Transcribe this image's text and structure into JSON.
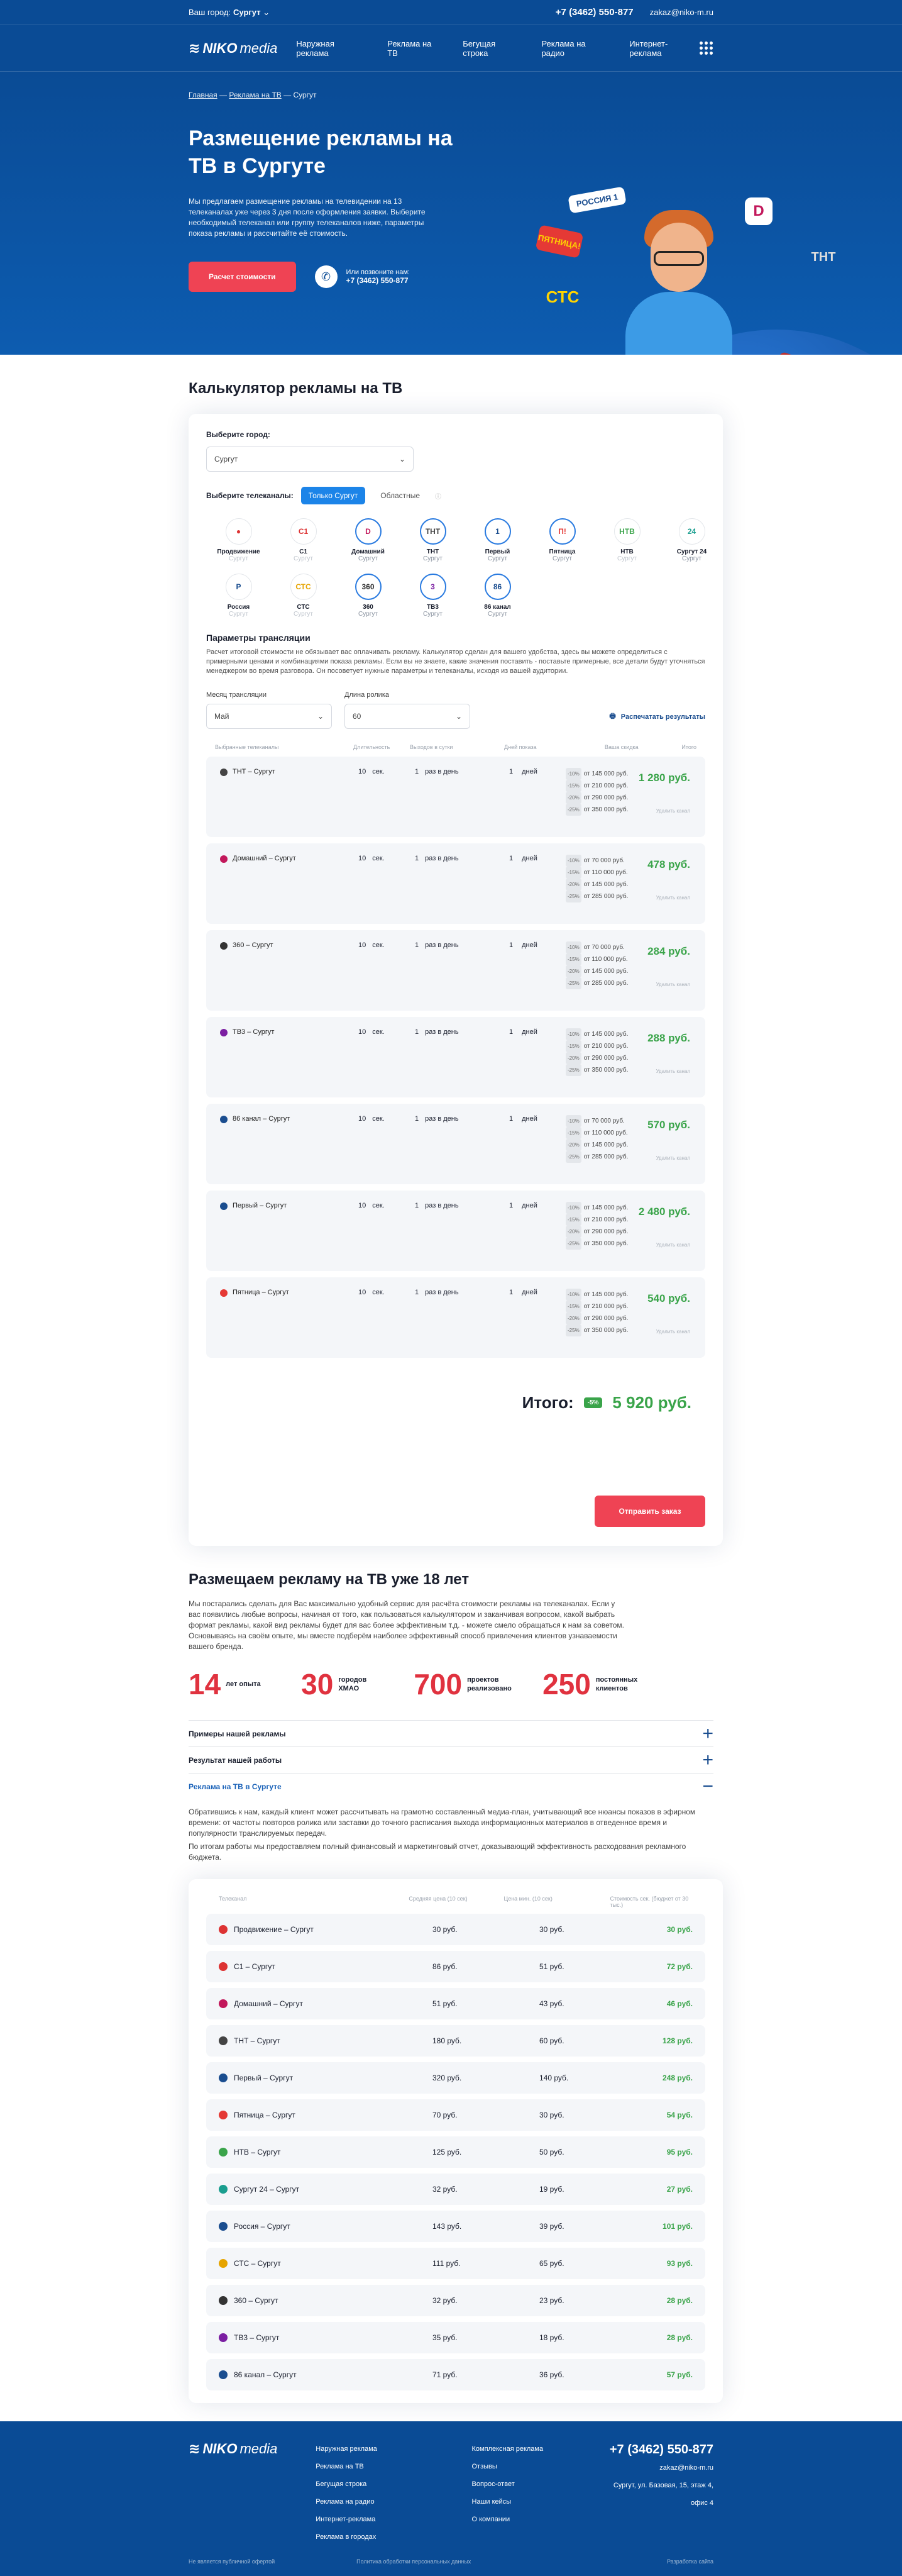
{
  "topbar": {
    "city_label": "Ваш город:",
    "city": "Сургут",
    "phone": "+7 (3462) 550-877",
    "email": "zakaz@niko-m.ru"
  },
  "nav": {
    "logo_a": "NIKO",
    "logo_b": "media",
    "items": [
      "Наружная реклама",
      "Реклама на ТВ",
      "Бегущая строка",
      "Реклама на радио",
      "Интернет-реклама"
    ]
  },
  "hero": {
    "breadcrumbs": [
      "Главная",
      "Реклама на ТВ",
      "Сургут"
    ],
    "title": "Размещение рекламы на ТВ в Сургуте",
    "text": "Мы предлагаем размещение рекламы на телевидении на 13 телеканалах уже через 3 дня после оформления заявки. Выберите необходимый телеканал или группу телеканалов ниже, параметры показа рекламы и рассчитайте её стоимость.",
    "cta": "Расчет стоимости",
    "call_label": "Или позвоните нам:",
    "phone": "+7 (3462) 550-877",
    "badges": [
      "РОССИЯ 1",
      "ПЯТНИЦА!",
      "СТС",
      "ТНТ",
      "D"
    ]
  },
  "calc": {
    "title": "Калькулятор рекламы на ТВ",
    "city_label": "Выберите город:",
    "city": "Сургут",
    "channels_label": "Выберите телеканалы:",
    "tab_local": "Только Сургут",
    "tab_regional": "Областные",
    "channels": [
      {
        "name": "Продвижение",
        "city": "Сургут",
        "mark": "●",
        "color": "#d33",
        "sel": false,
        "dim": true
      },
      {
        "name": "C1",
        "city": "Сургут",
        "mark": "C1",
        "color": "#d33",
        "sel": false,
        "dim": true
      },
      {
        "name": "Домашний",
        "city": "Сургут",
        "mark": "D",
        "color": "#c2185b",
        "sel": true,
        "dim": false
      },
      {
        "name": "ТНТ",
        "city": "Сургут",
        "mark": "ТНТ",
        "color": "#444",
        "sel": true,
        "dim": false
      },
      {
        "name": "Первый",
        "city": "Сургут",
        "mark": "1",
        "color": "#1a4d8f",
        "sel": true,
        "dim": false
      },
      {
        "name": "Пятница",
        "city": "Сургут",
        "mark": "П!",
        "color": "#e53935",
        "sel": true,
        "dim": false
      },
      {
        "name": "НТВ",
        "city": "Сургут",
        "mark": "НТВ",
        "color": "#3aa44a",
        "sel": false,
        "dim": true
      },
      {
        "name": "Сургут 24",
        "city": "Сургут",
        "mark": "24",
        "color": "#1a9e8f",
        "sel": false,
        "dim": false
      },
      {
        "name": "Россия",
        "city": "Сургут",
        "mark": "Р",
        "color": "#1a4d8f",
        "sel": false,
        "dim": true
      },
      {
        "name": "СТС",
        "city": "Сургут",
        "mark": "СТС",
        "color": "#e6a400",
        "sel": false,
        "dim": true
      },
      {
        "name": "360",
        "city": "Сургут",
        "mark": "360",
        "color": "#333",
        "sel": true,
        "dim": false
      },
      {
        "name": "ТВ3",
        "city": "Сургут",
        "mark": "3",
        "color": "#7b1fa2",
        "sel": true,
        "dim": false
      },
      {
        "name": "86 канал",
        "city": "Сургут",
        "mark": "86",
        "color": "#1a4d8f",
        "sel": true,
        "dim": false
      }
    ],
    "params_title": "Параметры трансляции",
    "params_text": "Расчет итоговой стоимости не обязывает вас оплачивать рекламу. Калькулятор сделан для вашего удобства, здесь вы можете определиться с примерными ценами и комбинациями показа рекламы. Если вы не знаете, какие значения поставить - поставьте примерные, все детали будут уточняться менеджером во время разговора. Он посоветует нужные параметры и телеканалы, исходя из вашей аудитории.",
    "month_label": "Месяц трансляции",
    "month": "Май",
    "dur_label": "Длина ролика",
    "dur": "60",
    "download": "Распечатать результаты",
    "headers": [
      "Выбранные телеканалы",
      "Длительность",
      "Выходов в сутки",
      "Дней показа",
      "Ваша скидка",
      "Итого"
    ],
    "rows": [
      {
        "name": "ТНТ – Сургут",
        "color": "#444",
        "sec": "10",
        "per": "1",
        "days": "1",
        "d": [
          "от 145 000 руб.",
          "от 210 000 руб.",
          "от 290 000 руб.",
          "от 350 000 руб."
        ],
        "price": "1 280 руб."
      },
      {
        "name": "Домашний – Сургут",
        "color": "#c2185b",
        "sec": "10",
        "per": "1",
        "days": "1",
        "d": [
          "от 70 000 руб.",
          "от 110 000 руб.",
          "от 145 000 руб.",
          "от 285 000 руб."
        ],
        "price": "478 руб."
      },
      {
        "name": "360 – Сургут",
        "color": "#333",
        "sec": "10",
        "per": "1",
        "days": "1",
        "d": [
          "от 70 000 руб.",
          "от 110 000 руб.",
          "от 145 000 руб.",
          "от 285 000 руб."
        ],
        "price": "284 руб."
      },
      {
        "name": "ТВ3 – Сургут",
        "color": "#7b1fa2",
        "sec": "10",
        "per": "1",
        "days": "1",
        "d": [
          "от 145 000 руб.",
          "от 210 000 руб.",
          "от 290 000 руб.",
          "от 350 000 руб."
        ],
        "price": "288 руб."
      },
      {
        "name": "86 канал – Сургут",
        "color": "#1a4d8f",
        "sec": "10",
        "per": "1",
        "days": "1",
        "d": [
          "от 70 000 руб.",
          "от 110 000 руб.",
          "от 145 000 руб.",
          "от 285 000 руб."
        ],
        "price": "570 руб."
      },
      {
        "name": "Первый – Сургут",
        "color": "#1a4d8f",
        "sec": "10",
        "per": "1",
        "days": "1",
        "d": [
          "от 145 000 руб.",
          "от 210 000 руб.",
          "от 290 000 руб.",
          "от 350 000 руб."
        ],
        "price": "2 480 руб."
      },
      {
        "name": "Пятница – Сургут",
        "color": "#e53935",
        "sec": "10",
        "per": "1",
        "days": "1",
        "d": [
          "от 145 000 руб.",
          "от 210 000 руб.",
          "от 290 000 руб.",
          "от 350 000 руб."
        ],
        "price": "540 руб."
      }
    ],
    "unit_sec": "сек.",
    "unit_per": "раз в день",
    "unit_days": "дней",
    "pcts": [
      "-10%",
      "-15%",
      "-20%",
      "-25%"
    ],
    "del": "Удалить канал",
    "total_label": "Итого:",
    "total_pct": "-5%",
    "total": "5 920 руб.",
    "order": "Отправить заказ"
  },
  "about": {
    "title": "Размещаем рекламу на ТВ уже 18 лет",
    "text": "Мы постарались сделать для Вас максимально удобный сервис для расчёта стоимости рекламы на телеканалах. Если у вас появились любые вопросы, начиная от того, как пользоваться калькулятором и заканчивая вопросом, какой выбрать формат рекламы, какой вид рекламы будет для вас более эффективным т.д. - можете смело обращаться к нам за советом. Основываясь на своём опыте, мы вместе подберём наиболее эффективный способ привлечения клиентов узнаваемости вашего бренда.",
    "stats": [
      {
        "n": "14",
        "l": "лет опыта"
      },
      {
        "n": "30",
        "l": "городов ХМАО"
      },
      {
        "n": "700",
        "l": "проектов реализовано"
      },
      {
        "n": "250",
        "l": "постоянных клиентов"
      }
    ],
    "acc": [
      "Примеры нашей рекламы",
      "Результат нашей работы",
      "Реклама на ТВ в Сургуте"
    ],
    "acc_text1": "Обратившись к нам, каждый клиент может рассчитывать на грамотно составленный медиа-план, учитывающий все нюансы показов в эфирном времени: от частоты повторов ролика или заставки до точного расписания выхода информационных материалов в отведенное время и популярности транслируемых передач.",
    "acc_text2": "По итогам работы мы предоставляем полный финансовый и маркетинговый отчет, доказывающий эффективность расходования рекламного бюджета."
  },
  "prices": {
    "headers": [
      "Телеканал",
      "Средняя цена (10 сек)",
      "Цена мин. (10 сек)",
      "Стоимость сек. (бюджет от 30 тыс.)"
    ],
    "rows": [
      {
        "n": "Продвижение – Сургут",
        "a": "30 руб.",
        "b": "30 руб.",
        "c": "30 руб.",
        "col": "#d33"
      },
      {
        "n": "C1 – Сургут",
        "a": "86 руб.",
        "b": "51 руб.",
        "c": "72 руб.",
        "col": "#d33"
      },
      {
        "n": "Домашний – Сургут",
        "a": "51 руб.",
        "b": "43 руб.",
        "c": "46 руб.",
        "col": "#c2185b"
      },
      {
        "n": "ТНТ – Сургут",
        "a": "180 руб.",
        "b": "60 руб.",
        "c": "128 руб.",
        "col": "#444"
      },
      {
        "n": "Первый – Сургут",
        "a": "320 руб.",
        "b": "140 руб.",
        "c": "248 руб.",
        "col": "#1a4d8f"
      },
      {
        "n": "Пятница – Сургут",
        "a": "70 руб.",
        "b": "30 руб.",
        "c": "54 руб.",
        "col": "#e53935"
      },
      {
        "n": "НТВ – Сургут",
        "a": "125 руб.",
        "b": "50 руб.",
        "c": "95 руб.",
        "col": "#3aa44a"
      },
      {
        "n": "Сургут 24 – Сургут",
        "a": "32 руб.",
        "b": "19 руб.",
        "c": "27 руб.",
        "col": "#1a9e8f"
      },
      {
        "n": "Россия – Сургут",
        "a": "143 руб.",
        "b": "39 руб.",
        "c": "101 руб.",
        "col": "#1a4d8f"
      },
      {
        "n": "СТС – Сургут",
        "a": "111 руб.",
        "b": "65 руб.",
        "c": "93 руб.",
        "col": "#e6a400"
      },
      {
        "n": "360 – Сургут",
        "a": "32 руб.",
        "b": "23 руб.",
        "c": "28 руб.",
        "col": "#333"
      },
      {
        "n": "ТВ3 – Сургут",
        "a": "35 руб.",
        "b": "18 руб.",
        "c": "28 руб.",
        "col": "#7b1fa2"
      },
      {
        "n": "86 канал – Сургут",
        "a": "71 руб.",
        "b": "36 руб.",
        "c": "57 руб.",
        "col": "#1a4d8f"
      }
    ]
  },
  "footer": {
    "col1": [
      "Наружная реклама",
      "Реклама на ТВ",
      "Бегущая строка",
      "Реклама на радио",
      "Интернет-реклама",
      "Реклама в городах"
    ],
    "col2": [
      "Комплексная реклама",
      "Отзывы",
      "Вопрос-ответ",
      "Наши кейсы",
      "О компании"
    ],
    "phone": "+7 (3462) 550-877",
    "email": "zakaz@niko-m.ru",
    "address": "Сургут, ул. Базовая, 15, этаж 4, офис 4",
    "copy": "Не является публичной офертой",
    "policy": "Политика обработки персональных данных",
    "dev": "Разработка сайта"
  }
}
